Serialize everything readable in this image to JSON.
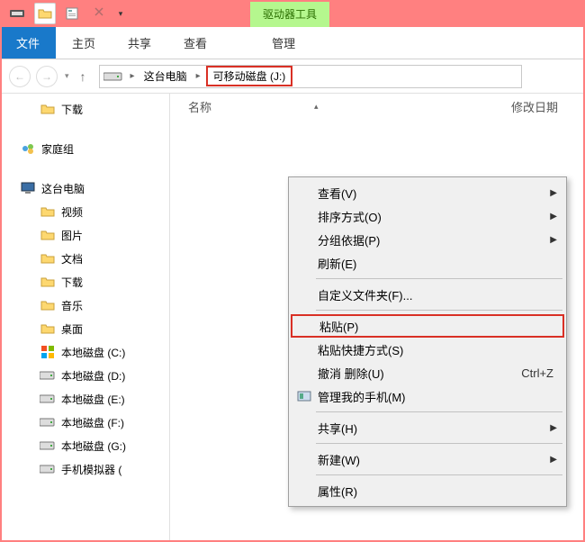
{
  "titlebar": {
    "context_tab": "驱动器工具"
  },
  "ribbon": {
    "file": "文件",
    "home": "主页",
    "share": "共享",
    "view": "查看",
    "manage": "管理"
  },
  "breadcrumb": {
    "this_pc": "这台电脑",
    "removable": "可移动磁盘 (J:)"
  },
  "columns": {
    "name": "名称",
    "date_modified": "修改日期"
  },
  "sidebar": {
    "downloads_top": "下载",
    "homegroup": "家庭组",
    "this_pc": "这台电脑",
    "children": [
      {
        "label": "视频",
        "icon": "folder-icon"
      },
      {
        "label": "图片",
        "icon": "folder-icon"
      },
      {
        "label": "文档",
        "icon": "folder-icon"
      },
      {
        "label": "下载",
        "icon": "folder-icon"
      },
      {
        "label": "音乐",
        "icon": "folder-icon"
      },
      {
        "label": "桌面",
        "icon": "folder-icon"
      },
      {
        "label": "本地磁盘 (C:)",
        "icon": "winlogo-icon"
      },
      {
        "label": "本地磁盘 (D:)",
        "icon": "drive-icon"
      },
      {
        "label": "本地磁盘 (E:)",
        "icon": "drive-icon"
      },
      {
        "label": "本地磁盘 (F:)",
        "icon": "drive-icon"
      },
      {
        "label": "本地磁盘 (G:)",
        "icon": "drive-icon"
      },
      {
        "label": "手机模拟器 (",
        "icon": "drive-icon"
      }
    ]
  },
  "context_menu": {
    "groups": [
      [
        {
          "label": "查看(V)",
          "submenu": true
        },
        {
          "label": "排序方式(O)",
          "submenu": true
        },
        {
          "label": "分组依据(P)",
          "submenu": true
        },
        {
          "label": "刷新(E)"
        }
      ],
      [
        {
          "label": "自定义文件夹(F)..."
        }
      ],
      [
        {
          "label": "粘贴(P)",
          "highlight": true
        },
        {
          "label": "粘贴快捷方式(S)"
        },
        {
          "label": "撤消 删除(U)",
          "shortcut": "Ctrl+Z"
        },
        {
          "label": "管理我的手机(M)",
          "icon": "phonemgr-icon"
        }
      ],
      [
        {
          "label": "共享(H)",
          "submenu": true
        }
      ],
      [
        {
          "label": "新建(W)",
          "submenu": true
        }
      ],
      [
        {
          "label": "属性(R)"
        }
      ]
    ]
  }
}
